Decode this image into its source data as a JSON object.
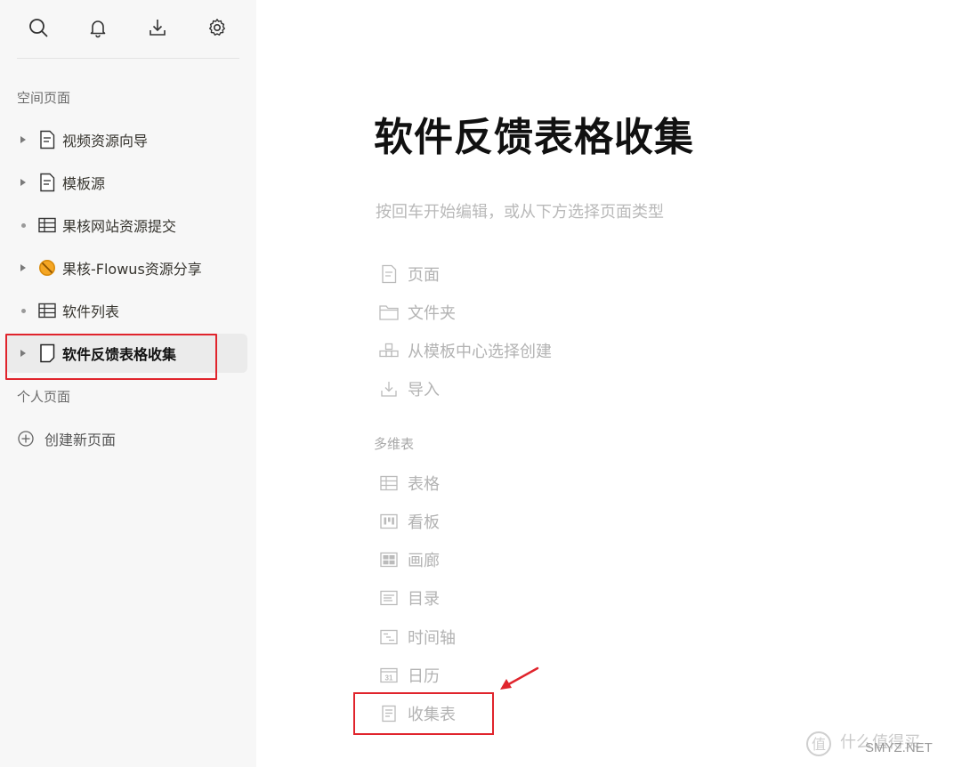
{
  "sidebar": {
    "top_icons": [
      "search-icon",
      "bell-icon",
      "download-icon",
      "gear-icon"
    ],
    "space_section": "空间页面",
    "items": [
      {
        "label": "视频资源向导",
        "toggle": "caret",
        "icon": "page-icon"
      },
      {
        "label": "模板源",
        "toggle": "caret",
        "icon": "page-icon"
      },
      {
        "label": "果核网站资源提交",
        "toggle": "dot",
        "icon": "table-icon"
      },
      {
        "label": "果核-Flowus资源分享",
        "toggle": "caret",
        "icon": "forbidden-emoji-icon"
      },
      {
        "label": "软件列表",
        "toggle": "dot",
        "icon": "table-icon"
      },
      {
        "label": "软件反馈表格收集",
        "toggle": "caret",
        "icon": "blank-page-icon",
        "active": true
      }
    ],
    "personal_section": "个人页面",
    "create_new": "创建新页面"
  },
  "main": {
    "title": "软件反馈表格收集",
    "hint": "按回车开始编辑，或从下方选择页面类型",
    "options": [
      {
        "label": "页面",
        "icon": "page-icon"
      },
      {
        "label": "文件夹",
        "icon": "folder-icon"
      },
      {
        "label": "从模板中心选择创建",
        "icon": "template-icon"
      },
      {
        "label": "导入",
        "icon": "import-icon"
      }
    ],
    "db_section": "多维表",
    "db_options": [
      {
        "label": "表格",
        "icon": "table-icon"
      },
      {
        "label": "看板",
        "icon": "kanban-icon"
      },
      {
        "label": "画廊",
        "icon": "gallery-icon"
      },
      {
        "label": "目录",
        "icon": "list-icon"
      },
      {
        "label": "时间轴",
        "icon": "timeline-icon"
      },
      {
        "label": "日历",
        "icon": "calendar-icon"
      },
      {
        "label": "收集表",
        "icon": "form-icon"
      }
    ]
  },
  "watermark": {
    "text": "SMYZ.NET",
    "brand": "什么值得买"
  },
  "colors": {
    "accent_red": "#e0242c",
    "sidebar_bg": "#f7f7f7",
    "muted": "#b3b3b3"
  }
}
